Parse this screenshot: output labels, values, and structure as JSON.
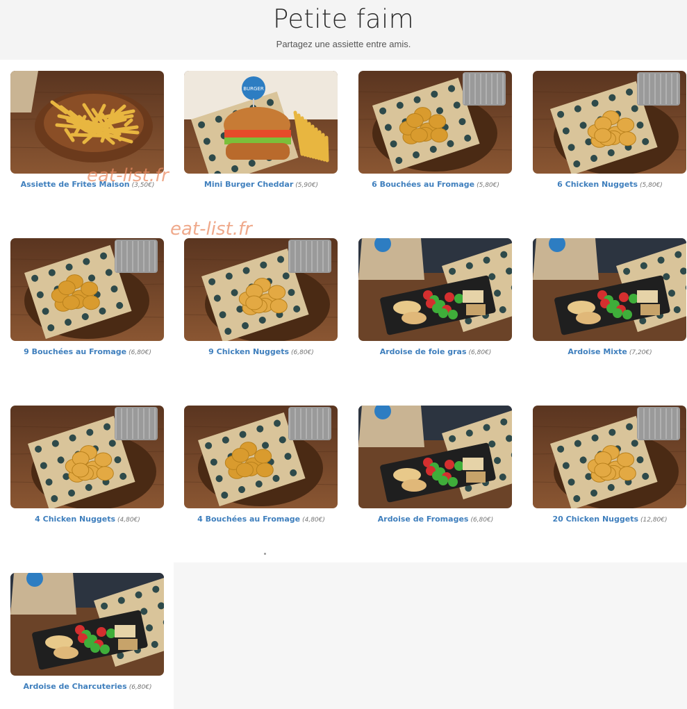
{
  "header": {
    "title": "Petite faim",
    "subtitle": "Partagez une assiette entre amis."
  },
  "items": [
    {
      "name": "Assiette de Frites Maison",
      "price": "(3,50€)",
      "image": "fries"
    },
    {
      "name": "Mini Burger Cheddar",
      "price": "(5,90€)",
      "image": "burger"
    },
    {
      "name": "6 Bouchées au Fromage",
      "price": "(5,80€)",
      "image": "bites"
    },
    {
      "name": "6 Chicken Nuggets",
      "price": "(5,80€)",
      "image": "nuggets"
    },
    {
      "name": "9 Bouchées au Fromage",
      "price": "(6,80€)",
      "image": "bites"
    },
    {
      "name": "9 Chicken Nuggets",
      "price": "(6,80€)",
      "image": "nuggets"
    },
    {
      "name": "Ardoise de foie gras",
      "price": "(6,80€)",
      "image": "slate"
    },
    {
      "name": "Ardoise Mixte",
      "price": "(7,20€)",
      "image": "slate"
    },
    {
      "name": "4 Chicken Nuggets",
      "price": "(4,80€)",
      "image": "nuggets"
    },
    {
      "name": "4 Bouchées au Fromage",
      "price": "(4,80€)",
      "image": "bites"
    },
    {
      "name": "Ardoise de Fromages",
      "price": "(6,80€)",
      "image": "slate"
    },
    {
      "name": "20 Chicken Nuggets",
      "price": "(12,80€)",
      "image": "nuggets"
    },
    {
      "name": "Ardoise de Charcuteries",
      "price": "(6,80€)",
      "image": "slate"
    }
  ],
  "watermarks": [
    "eat-list.fr",
    "eat-list.fr"
  ],
  "colors": {
    "link": "#3f7fbd",
    "header_bg": "#f4f4f4",
    "wood": "#7a4a2a"
  }
}
